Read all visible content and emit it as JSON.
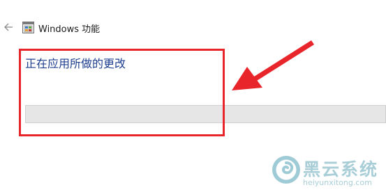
{
  "window": {
    "title": "Windows 功能",
    "back_icon": "back-arrow-icon",
    "app_icon": "windows-features-icon"
  },
  "content": {
    "status_text": "正在应用所做的更改",
    "progress": 0
  },
  "annotation": {
    "box_color": "#e8252a",
    "arrow_color": "#e8252a"
  },
  "watermark": {
    "brand": "黑云系统",
    "domain": "heiyunxitong.com"
  }
}
